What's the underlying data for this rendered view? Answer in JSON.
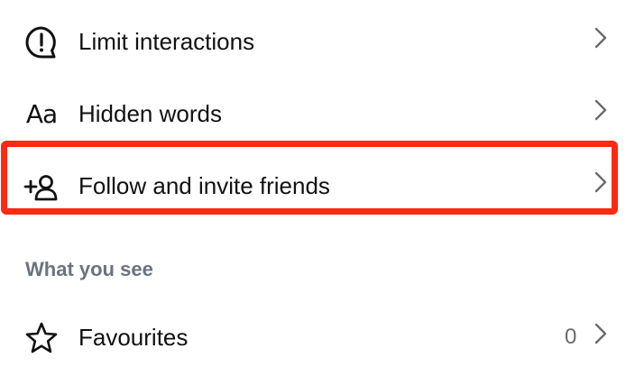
{
  "menu": {
    "items": [
      {
        "label": "Limit interactions",
        "icon": "exclamation-bubble-icon"
      },
      {
        "label": "Hidden words",
        "icon": "aa-text-icon",
        "icon_text": "Aa"
      },
      {
        "label": "Follow and invite friends",
        "icon": "add-person-icon",
        "highlighted": true
      }
    ],
    "section_header": "What you see",
    "section_items": [
      {
        "label": "Favourites",
        "icon": "star-icon",
        "count": "0"
      }
    ]
  },
  "highlight_color": "#ff2a12"
}
